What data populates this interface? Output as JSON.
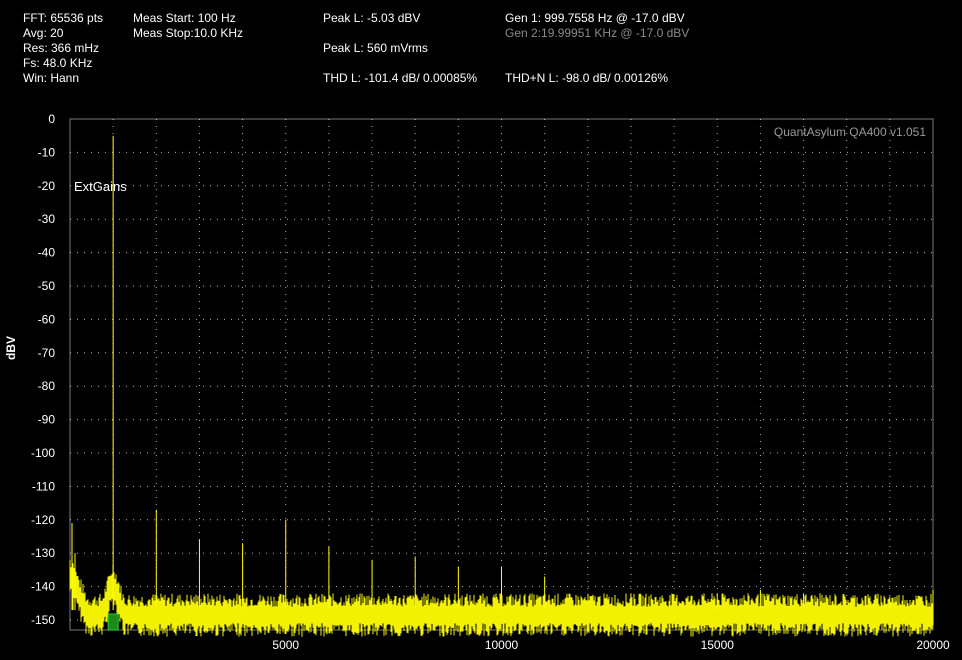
{
  "header": {
    "fft": "FFT: 65536 pts",
    "avg": "Avg: 20",
    "res": "Res: 366 mHz",
    "fs": "Fs: 48.0 KHz",
    "win": "Win: Hann",
    "meas_start": "Meas Start: 100 Hz",
    "meas_stop": "Meas Stop:10.0 KHz",
    "peak_dbv": "Peak L: -5.03 dBV",
    "peak_vrms": "Peak L: 560 mVrms",
    "thd": "THD L: -101.4 dB/ 0.00085%",
    "thdn": "THD+N L: -98.0 dB/ 0.00126%",
    "gen1": "Gen 1: 999.7558 Hz @ -17.0  dBV",
    "gen2": "Gen 2:19.99951 KHz @ -17.0  dBV"
  },
  "colors": {
    "trace": "#ffff00",
    "background": "#000000",
    "marker": "#1a8a1a",
    "grid": "#ffffff"
  },
  "chart_data": {
    "type": "line",
    "watermark": "QuantAsylum QA400 v1.051",
    "annotation": "ExtGains",
    "xlabel": "",
    "ylabel": "dBV",
    "xlim": [
      0,
      20000
    ],
    "ylim": [
      -153,
      0
    ],
    "xticks": [
      5000,
      10000,
      15000,
      20000
    ],
    "yticks": [
      0,
      -10,
      -20,
      -30,
      -40,
      -50,
      -60,
      -70,
      -80,
      -90,
      -100,
      -110,
      -120,
      -130,
      -140,
      -150
    ],
    "grid": true,
    "noise_floor": -147,
    "marker_frequency": 1000,
    "series": [
      {
        "peaks": [
          {
            "x": 1000,
            "y": -5
          },
          {
            "x": 2000,
            "y": -117
          },
          {
            "x": 3000,
            "y": -126
          },
          {
            "x": 4000,
            "y": -127
          },
          {
            "x": 5000,
            "y": -120
          },
          {
            "x": 6000,
            "y": -128
          },
          {
            "x": 7000,
            "y": -132
          },
          {
            "x": 8000,
            "y": -131
          },
          {
            "x": 9000,
            "y": -134
          },
          {
            "x": 10000,
            "y": -134
          },
          {
            "x": 11000,
            "y": -137
          },
          {
            "x": 13000,
            "y": -142
          },
          {
            "x": 15000,
            "y": -142
          },
          {
            "x": 16000,
            "y": -141
          },
          {
            "x": 17000,
            "y": -142
          },
          {
            "x": 19000,
            "y": -143
          },
          {
            "x": 20000,
            "y": -141
          }
        ]
      }
    ]
  }
}
